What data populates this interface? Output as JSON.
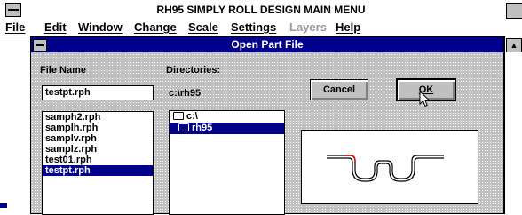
{
  "app": {
    "title": "RH95 SIMPLY ROLL DESIGN MAIN MENU"
  },
  "menubar": {
    "items": [
      {
        "label": "File",
        "enabled": true
      },
      {
        "label": "Edit",
        "enabled": true
      },
      {
        "label": "Window",
        "enabled": true
      },
      {
        "label": "Change",
        "enabled": true
      },
      {
        "label": "Scale",
        "enabled": true
      },
      {
        "label": "Settings",
        "enabled": true
      },
      {
        "label": "Layers",
        "enabled": false
      },
      {
        "label": "Help",
        "enabled": true
      }
    ]
  },
  "dialog": {
    "title": "Open Part File",
    "file_name_label": "File Name",
    "file_name_value": "testpt.rph",
    "files": [
      "samph2.rph",
      "samplh.rph",
      "samplv.rph",
      "samplz.rph",
      "test01.rph",
      "testpt.rph"
    ],
    "selected_file_index": 5,
    "directories_label": "Directories:",
    "current_dir": "c:\\rh95",
    "dir_tree": [
      "c:\\",
      "rh95"
    ],
    "selected_dir_index": 1,
    "cancel_label": "Cancel",
    "ok_label": "OK"
  },
  "colors": {
    "titlebar": "#00008b",
    "selection": "#00008b",
    "dialog_bg": "#c0c0c0",
    "preview_stroke": "#000000",
    "preview_accent": "#cc0000"
  }
}
